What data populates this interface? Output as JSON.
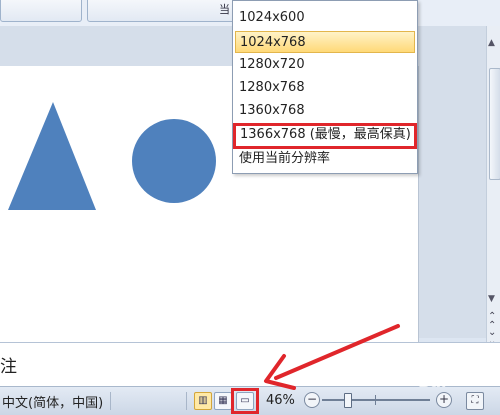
{
  "ribbon": {
    "button_glyph": "当"
  },
  "resolution_menu": {
    "options": [
      "1024x600",
      "1024x768",
      "1280x720",
      "1280x768",
      "1360x768",
      "1366x768 (最慢，最高保真)",
      "使用当前分辨率"
    ],
    "highlighted_index": 1,
    "red_boxed_index": 5
  },
  "slide": {
    "shapes": [
      "triangle",
      "circle"
    ],
    "shape_color": "#4f81bd"
  },
  "notes": {
    "text": "注"
  },
  "status_bar": {
    "language": "中文(简体，中国)",
    "zoom_level": "46%",
    "zoom_out": "−",
    "zoom_in": "+",
    "view_normal_icon": "normal-view-icon",
    "view_sorter_icon": "slide-sorter-icon",
    "view_slideshow_icon": "slideshow-icon",
    "fit_icon": "fit-window-icon"
  },
  "annotation": {
    "color": "#e0262b"
  },
  "watermark": {
    "text": "Bai"
  }
}
